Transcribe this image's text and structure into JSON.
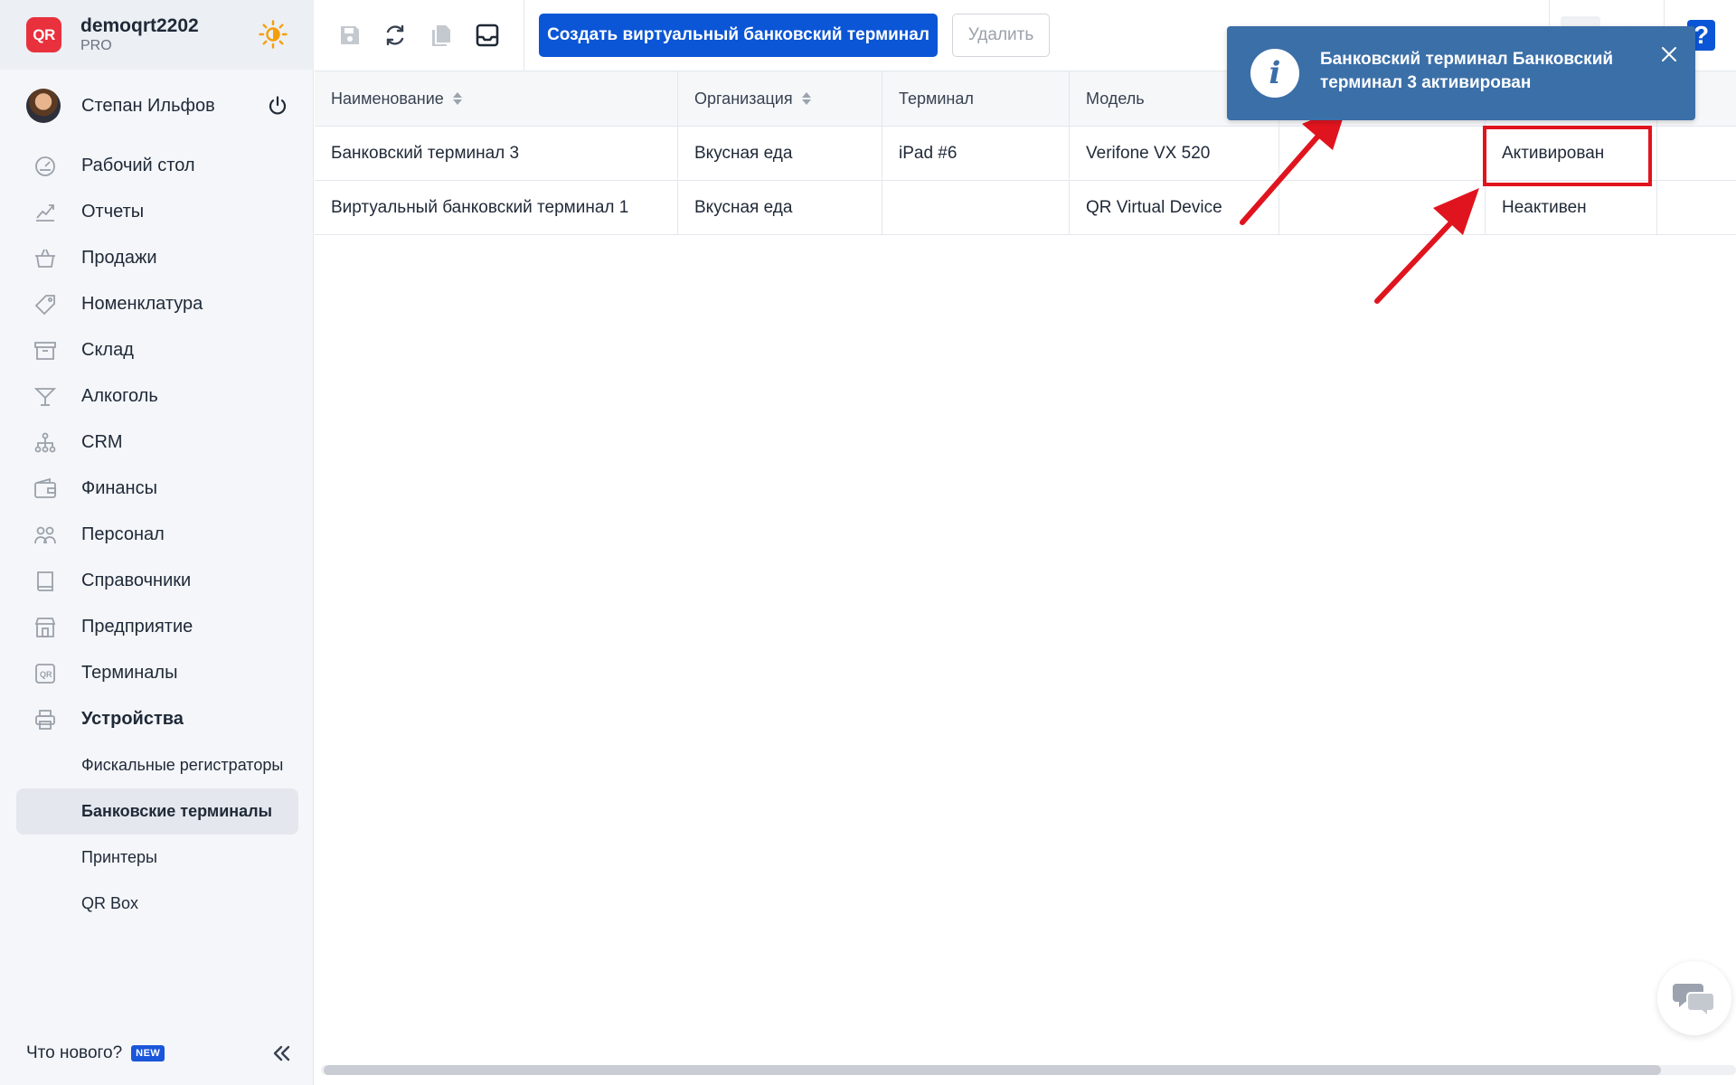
{
  "brand": {
    "logo": "QR",
    "name": "demoqrt2202",
    "plan": "PRO"
  },
  "user": {
    "name": "Степан Ильфов"
  },
  "sidebar": {
    "items": [
      {
        "label": "Рабочий стол",
        "icon": "dashboard-icon"
      },
      {
        "label": "Отчеты",
        "icon": "reports-icon"
      },
      {
        "label": "Продажи",
        "icon": "basket-icon"
      },
      {
        "label": "Номенклатура",
        "icon": "tag-icon"
      },
      {
        "label": "Склад",
        "icon": "archive-icon"
      },
      {
        "label": "Алкоголь",
        "icon": "cocktail-icon"
      },
      {
        "label": "CRM",
        "icon": "hierarchy-icon"
      },
      {
        "label": "Финансы",
        "icon": "wallet-icon"
      },
      {
        "label": "Персонал",
        "icon": "people-icon"
      },
      {
        "label": "Справочники",
        "icon": "book-icon"
      },
      {
        "label": "Предприятие",
        "icon": "store-icon"
      },
      {
        "label": "Терминалы",
        "icon": "qr-terminal-icon"
      },
      {
        "label": "Устройства",
        "icon": "printer-icon"
      }
    ],
    "sub_items": [
      {
        "label": "Фискальные регистраторы"
      },
      {
        "label": "Банковские терминалы"
      },
      {
        "label": "Принтеры"
      },
      {
        "label": "QR Box"
      }
    ],
    "footer": {
      "whats_new": "Что нового?",
      "badge": "NEW"
    }
  },
  "toolbar": {
    "create_label": "Создать виртуальный банковский терминал",
    "delete_label": "Удалить",
    "help_label": "?"
  },
  "table": {
    "columns": [
      "Наименование",
      "Организация",
      "Терминал",
      "Модель",
      "",
      "",
      ""
    ],
    "rows": [
      [
        "Банковский терминал 3",
        "Вкусная еда",
        "iPad #6",
        "Verifone VX 520",
        "",
        "Активирован",
        ""
      ],
      [
        "Виртуальный банковский терминал 1",
        "Вкусная еда",
        "",
        "QR Virtual Device",
        "",
        "Неактивен",
        ""
      ]
    ]
  },
  "notification": {
    "text": "Банковский терминал Банковский терминал 3 активирован",
    "color": "#3b6fa8"
  },
  "colors": {
    "accent": "#0b56d6",
    "logo": "#e8313d",
    "highlight": "#e0141e"
  }
}
